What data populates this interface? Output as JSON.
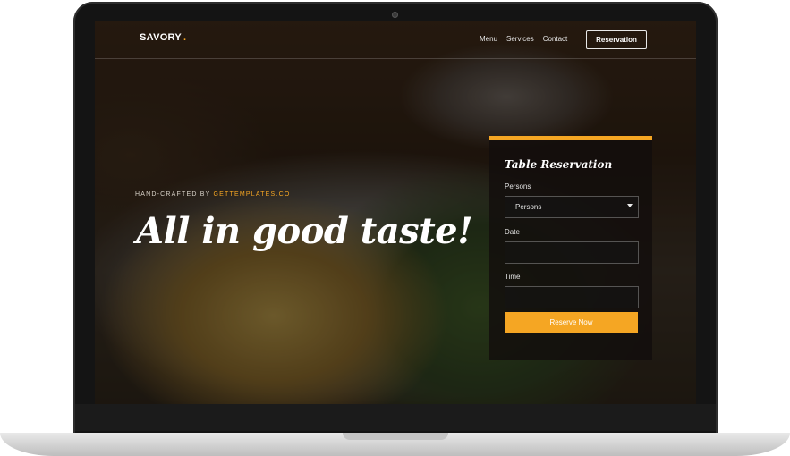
{
  "brand": {
    "name": "SAVORY",
    "dot": "."
  },
  "nav": {
    "links": [
      "Menu",
      "Services",
      "Contact"
    ],
    "reservation_button": "Reservation"
  },
  "hero": {
    "eyebrow_prefix": "HAND-CRAFTED BY ",
    "eyebrow_link": "GETTEMPLATES.CO",
    "title": "All in good taste!"
  },
  "reservation_form": {
    "title": "Table Reservation",
    "persons_label": "Persons",
    "persons_selected": "Persons",
    "date_label": "Date",
    "date_value": "",
    "time_label": "Time",
    "time_value": "",
    "submit_label": "Reserve Now"
  },
  "colors": {
    "accent": "#f5a623",
    "frame": "#141414",
    "panel": "#120e0c"
  }
}
